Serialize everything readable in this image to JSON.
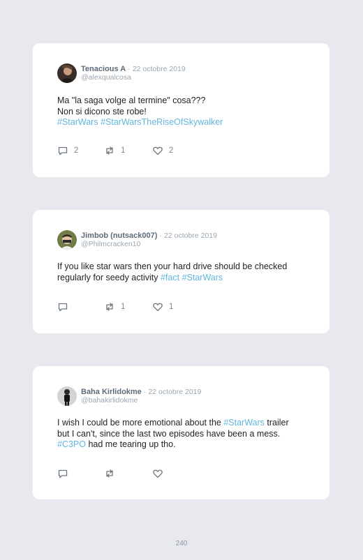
{
  "tweets": [
    {
      "name": "Tenacious A",
      "separator": "·",
      "date": "22 octobre 2019",
      "handle": "@alexqualcosa",
      "lines": [
        [
          {
            "t": "Ma \"la saga volge al termine\" cosa???"
          }
        ],
        [
          {
            "t": "Non si dicono ste robe!"
          }
        ],
        [
          {
            "t": "#StarWars",
            "tag": true
          },
          {
            "t": " "
          },
          {
            "t": "#StarWarsTheRiseOfSkywalker",
            "tag": true
          }
        ]
      ],
      "replies": "2",
      "retweets": "1",
      "likes": "2",
      "avatar_icon": "profile-photo-icon"
    },
    {
      "name": "Jimbob (nutsack007)",
      "separator": "·",
      "date": "22 octobre 2019",
      "handle": "@Philmcracken10",
      "lines": [
        [
          {
            "t": "If you like star wars then your hard drive should be checked"
          }
        ],
        [
          {
            "t": "regularly for seedy activity "
          },
          {
            "t": "#fact",
            "tag": true
          },
          {
            "t": " "
          },
          {
            "t": "#StarWars",
            "tag": true
          }
        ]
      ],
      "replies": "",
      "retweets": "1",
      "likes": "1",
      "avatar_icon": "profile-photo-icon"
    },
    {
      "name": "Baha Kirlidokme",
      "separator": "·",
      "date": "22 octobre 2019",
      "handle": "@bahakirlidokme",
      "lines": [
        [
          {
            "t": "I wish I could be more emotional about the "
          },
          {
            "t": "#StarWars",
            "tag": true
          },
          {
            "t": " trailer"
          }
        ],
        [
          {
            "t": "but I can't, since the last two episodes have been a mess."
          }
        ],
        [
          {
            "t": "#C3PO",
            "tag": true
          },
          {
            "t": " had me tearing up tho."
          }
        ]
      ],
      "replies": "",
      "retweets": "",
      "likes": "",
      "avatar_icon": "profile-photo-icon"
    }
  ],
  "page_number": "240",
  "colors": {
    "background": "#e8e9ef",
    "card": "#ffffff",
    "hashtag": "#62b6dd",
    "name": "#5c6b7a",
    "muted": "#9aa6b2"
  }
}
